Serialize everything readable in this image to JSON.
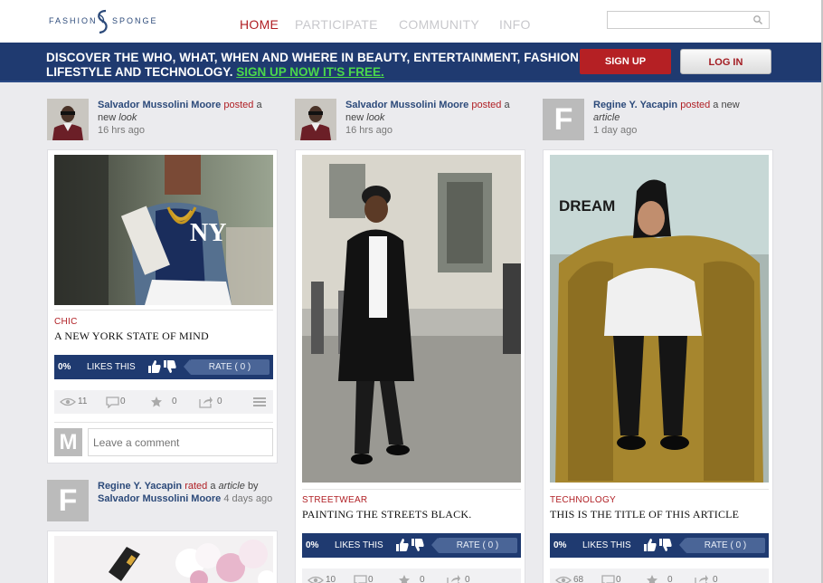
{
  "header": {
    "logo_left": "FASHION",
    "logo_right": "SPONGE",
    "nav": [
      "HOME",
      "PARTICIPATE",
      "COMMUNITY",
      "INFO"
    ],
    "search_placeholder": ""
  },
  "banner": {
    "line1": "DISCOVER THE WHO, WHAT, WHEN AND WHERE IN BEAUTY, ENTERTAINMENT, FASHION,",
    "line2": "LIFESTYLE AND TECHNOLOGY.",
    "signup_link": "SIGN UP NOW IT'S FREE.",
    "signup_button": "SIGN UP",
    "login_button": "LOG IN"
  },
  "posts": [
    {
      "avatar": "",
      "author": "Salvador Mussolini Moore",
      "action": "posted",
      "pre": "a new",
      "object": "look",
      "time": "16 hrs ago",
      "category": "CHIC",
      "title": "A NEW YORK STATE OF MIND",
      "like_pct": "0%",
      "likes_label": "LIKES THIS",
      "rate_label": "RATE ( 0 )",
      "stats": [
        "11",
        "0",
        "0",
        "0"
      ],
      "comment_avatar": "M",
      "comment_placeholder": "Leave a comment"
    },
    {
      "avatar": "",
      "author": "Salvador Mussolini Moore",
      "action": "posted",
      "pre": "a new",
      "object": "look",
      "time": "16 hrs ago",
      "category": "STREETWEAR",
      "title": "PAINTING THE STREETS BLACK.",
      "like_pct": "0%",
      "likes_label": "LIKES THIS",
      "rate_label": "RATE ( 0 )",
      "stats": [
        "10",
        "0",
        "0",
        "0"
      ]
    },
    {
      "avatar": "F",
      "author": "Regine Y. Yacapin",
      "action": "posted",
      "pre": "a new",
      "object": "article",
      "time": "1 day ago",
      "category": "TECHNOLOGY",
      "title": "THIS IS THE TITLE OF THIS ARTICLE",
      "like_pct": "0%",
      "likes_label": "LIKES THIS",
      "rate_label": "RATE ( 0 )",
      "stats": [
        "68",
        "0",
        "0",
        "0"
      ],
      "image_brand": "DREAM"
    },
    {
      "avatar": "F",
      "author": "Regine Y. Yacapin",
      "action": "rated",
      "pre": "a",
      "object": "article",
      "post": "by",
      "author2": "Salvador Mussolini Moore",
      "time": "4 days ago"
    }
  ],
  "colors": {
    "brand_red": "#b01f24",
    "brand_navy": "#1f3a70",
    "signup_green": "#4bd84b"
  }
}
